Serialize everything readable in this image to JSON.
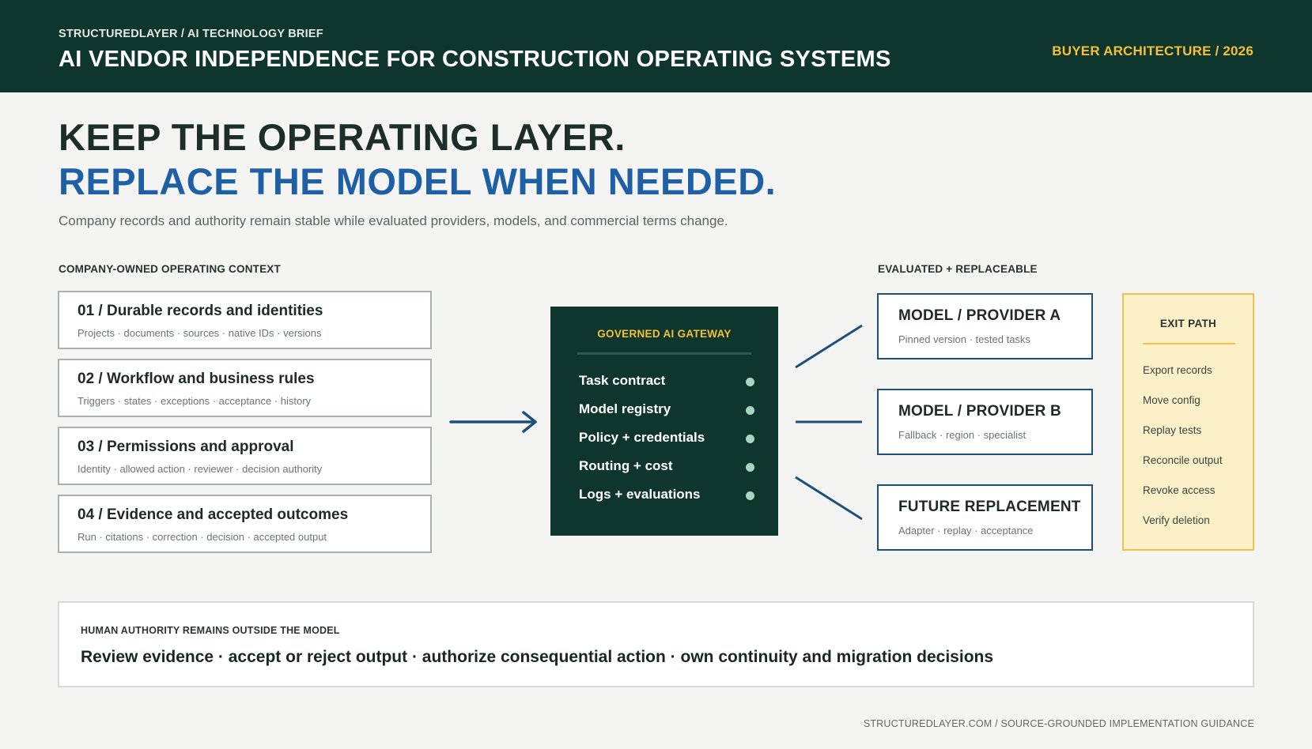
{
  "header": {
    "kicker": "STRUCTUREDLAYER / AI TECHNOLOGY BRIEF",
    "title": "AI VENDOR INDEPENDENCE FOR CONSTRUCTION OPERATING SYSTEMS",
    "badge": "BUYER ARCHITECTURE / 2026"
  },
  "hero": {
    "line1": "KEEP THE OPERATING LAYER.",
    "line2": "REPLACE THE MODEL WHEN NEEDED.",
    "subtitle": "Company records and authority remain stable while evaluated providers, models, and commercial terms change."
  },
  "context": {
    "label": "COMPANY-OWNED OPERATING CONTEXT",
    "cards": [
      {
        "title": "01 / Durable records and identities",
        "subtitle": "Projects · documents · sources · native IDs · versions"
      },
      {
        "title": "02 / Workflow and business rules",
        "subtitle": "Triggers · states · exceptions · acceptance · history"
      },
      {
        "title": "03 / Permissions and approval",
        "subtitle": "Identity · allowed action · reviewer · decision authority"
      },
      {
        "title": "04 / Evidence and accepted outcomes",
        "subtitle": "Run · citations · correction · decision · accepted output"
      }
    ]
  },
  "gateway": {
    "title": "GOVERNED AI GATEWAY",
    "items": [
      "Task contract",
      "Model registry",
      "Policy + credentials",
      "Routing + cost",
      "Logs + evaluations"
    ]
  },
  "providers": {
    "label": "EVALUATED + REPLACEABLE",
    "cards": [
      {
        "title": "MODEL / PROVIDER A",
        "subtitle": "Pinned version · tested tasks"
      },
      {
        "title": "MODEL / PROVIDER B",
        "subtitle": "Fallback · region · specialist"
      },
      {
        "title": "FUTURE REPLACEMENT",
        "subtitle": "Adapter · replay · acceptance"
      }
    ]
  },
  "exit_path": {
    "title": "EXIT PATH",
    "items": [
      "Export records",
      "Move config",
      "Replay tests",
      "Reconcile output",
      "Revoke access",
      "Verify deletion"
    ]
  },
  "authority": {
    "label": "HUMAN AUTHORITY REMAINS OUTSIDE THE MODEL",
    "text": "Review evidence · accept or reject output · authorize consequential action · own continuity and migration decisions"
  },
  "footer": {
    "text": "STRUCTUREDLAYER.COM / SOURCE-GROUNDED IMPLEMENTATION GUIDANCE"
  },
  "colors": {
    "dark_green": "#0f362c",
    "accent_blue": "#1e5fa6",
    "accent_yellow": "#f4c03c",
    "provider_border": "#1f4f7b"
  }
}
